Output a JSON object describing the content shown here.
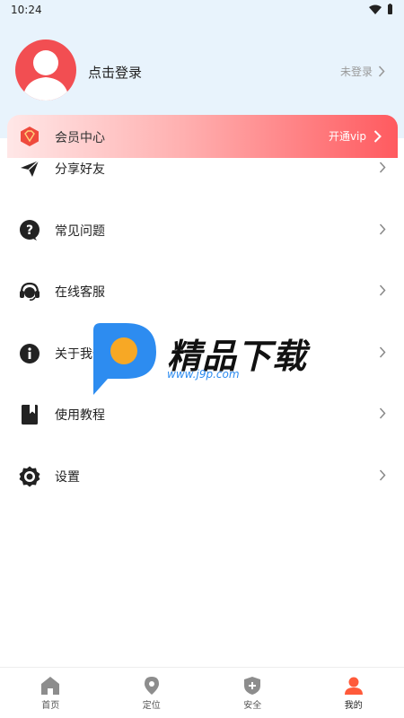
{
  "status_bar": {
    "time": "10:24"
  },
  "profile": {
    "login_prompt": "点击登录",
    "login_status": "未登录",
    "avatar_color": "#f24e52"
  },
  "vip": {
    "label": "会员中心",
    "action": "开通vip",
    "gradient_end": "#ff5a5f"
  },
  "menu": {
    "items": [
      {
        "label": "分享好友",
        "icon": "send-icon"
      },
      {
        "label": "常见问题",
        "icon": "question-icon"
      },
      {
        "label": "在线客服",
        "icon": "headset-icon"
      },
      {
        "label": "关于我们",
        "icon": "info-icon"
      },
      {
        "label": "使用教程",
        "icon": "book-icon"
      },
      {
        "label": "设置",
        "icon": "gear-icon"
      }
    ]
  },
  "watermark": {
    "title": "精品下载",
    "url": "www.j9p.com"
  },
  "tabbar": {
    "items": [
      {
        "label": "首页",
        "icon": "home-icon"
      },
      {
        "label": "定位",
        "icon": "location-icon"
      },
      {
        "label": "安全",
        "icon": "shield-icon"
      },
      {
        "label": "我的",
        "icon": "user-icon",
        "active": true
      }
    ],
    "active_color": "#ff5a3a"
  }
}
